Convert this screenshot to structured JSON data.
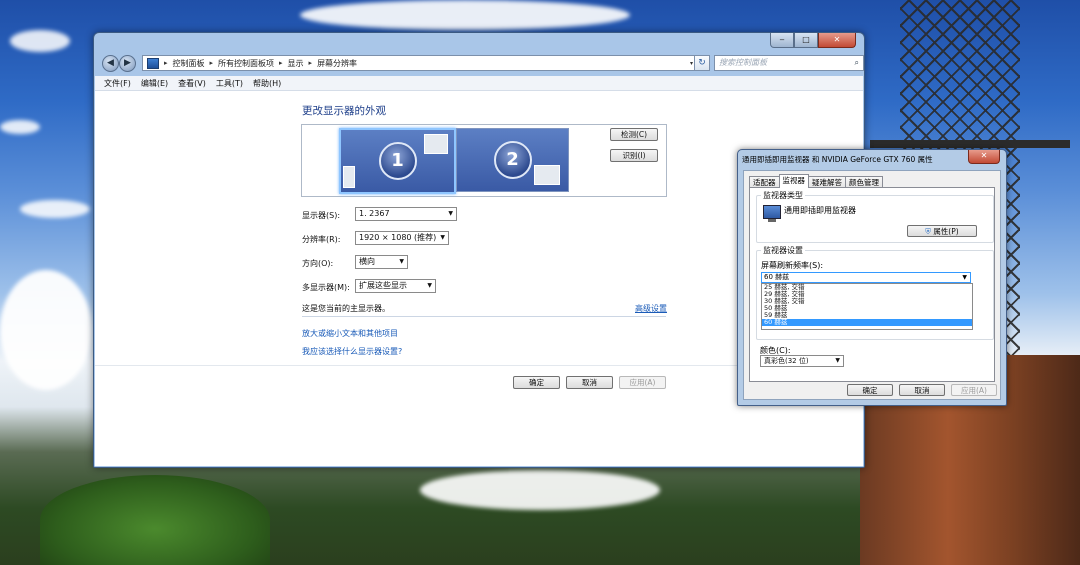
{
  "control_panel": {
    "window_controls": {
      "minimize": "‒",
      "maximize": "□",
      "close": "✕"
    },
    "nav": {
      "back": "◀",
      "forward": "▶",
      "dropdown": "▾",
      "refresh": "↻"
    },
    "breadcrumb": [
      "控制面板",
      "所有控制面板项",
      "显示",
      "屏幕分辨率"
    ],
    "search_placeholder": "搜索控制面板",
    "menu": [
      "文件(F)",
      "编辑(E)",
      "查看(V)",
      "工具(T)",
      "帮助(H)"
    ],
    "page_title": "更改显示器的外观",
    "monitors": [
      {
        "number": "1",
        "selected": true
      },
      {
        "number": "2",
        "selected": false
      }
    ],
    "detect_button": "检测(C)",
    "identify_button": "识别(I)",
    "display_label": "显示器(S):",
    "display_value": "1. 2367",
    "resolution_label": "分辨率(R):",
    "resolution_value": "1920 × 1080 (推荐)",
    "orientation_label": "方向(O):",
    "orientation_value": "横向",
    "multi_display_label": "多显示器(M):",
    "multi_display_value": "扩展这些显示",
    "main_display_text": "这是您当前的主显示器。",
    "advanced_link": "高级设置",
    "link_text_size": "放大或缩小文本和其他项目",
    "link_which_settings": "我应该选择什么显示器设置?",
    "ok_button": "确定",
    "cancel_button": "取消",
    "apply_button": "应用(A)"
  },
  "properties_dialog": {
    "title": "通用即插即用监视器 和 NVIDIA GeForce GTX 760 属性",
    "close": "✕",
    "tabs": [
      "适配器",
      "监视器",
      "疑难解答",
      "颜色管理"
    ],
    "active_tab": "监视器",
    "monitor_type_group": "监视器类型",
    "monitor_name": "通用即插即用监视器",
    "properties_button": "属性(P)",
    "monitor_settings_group": "监视器设置",
    "refresh_rate_label": "屏幕刷新频率(S):",
    "refresh_rate_selected": "60 赫兹",
    "refresh_rate_options": [
      "25 赫兹, 交错",
      "29 赫兹, 交错",
      "30 赫兹, 交错",
      "50 赫兹",
      "59 赫兹",
      "60 赫兹"
    ],
    "refresh_rate_highlighted_index": 5,
    "color_label": "颜色(C):",
    "color_value": "真彩色(32 位)",
    "ok_button": "确定",
    "cancel_button": "取消",
    "apply_button": "应用(A)"
  }
}
